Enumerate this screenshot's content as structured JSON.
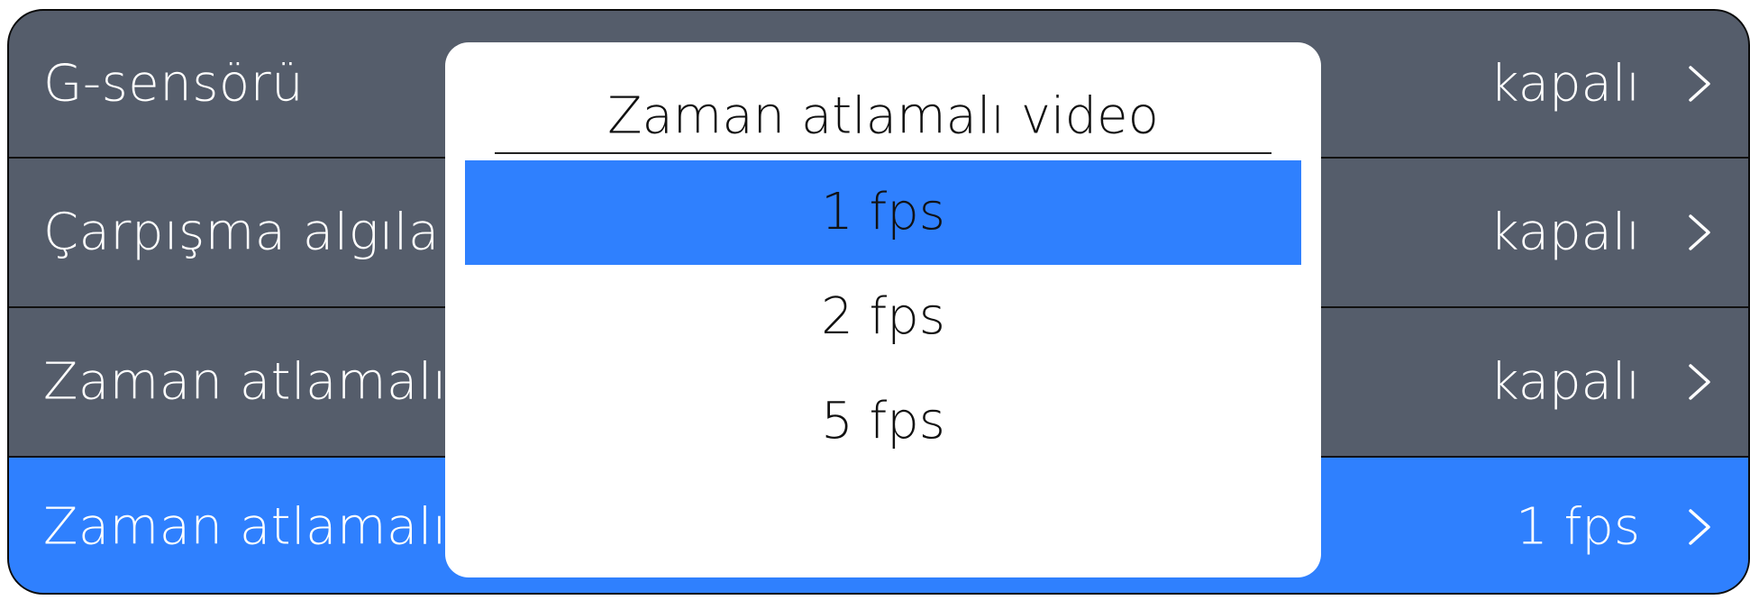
{
  "settings": {
    "rows": [
      {
        "label": "G-sensörü",
        "value": "kapalı",
        "selected": false
      },
      {
        "label": "Çarpışma algılama",
        "value": "kapalı",
        "selected": false
      },
      {
        "label": "Zaman atlamalı video",
        "value": "kapalı",
        "selected": false
      },
      {
        "label": "Zaman atlamalı video",
        "value": "1 fps",
        "selected": true
      }
    ],
    "chevron_icon": "chevron-right-icon",
    "colors": {
      "row_background": "#555d6b",
      "selected_background": "#2f80fe"
    }
  },
  "dialog": {
    "title": "Zaman atlamalı video",
    "options": [
      {
        "label": "1 fps",
        "selected": true
      },
      {
        "label": "2 fps",
        "selected": false
      },
      {
        "label": "5 fps",
        "selected": false
      }
    ]
  }
}
